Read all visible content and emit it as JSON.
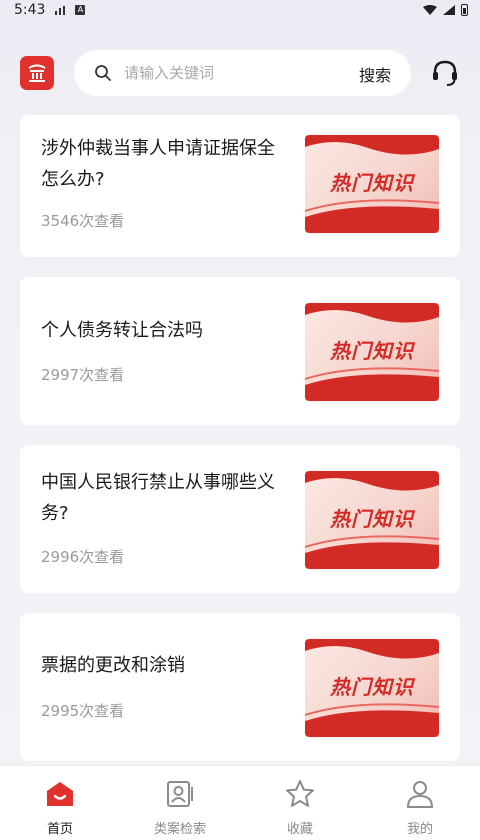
{
  "status": {
    "time": "5:43"
  },
  "search": {
    "placeholder": "请输入关键词",
    "button": "搜索"
  },
  "articles": [
    {
      "title": "涉外仲裁当事人申请证据保全怎么办?",
      "views": "3546次查看",
      "thumb_text": "热门知识"
    },
    {
      "title": "个人债务转让合法吗",
      "views": "2997次查看",
      "thumb_text": "热门知识"
    },
    {
      "title": "中国人民银行禁止从事哪些义务?",
      "views": "2996次查看",
      "thumb_text": "热门知识"
    },
    {
      "title": "票据的更改和涂销",
      "views": "2995次查看",
      "thumb_text": "热门知识"
    }
  ],
  "tabs": [
    {
      "label": "首页",
      "icon": "home-icon",
      "active": true
    },
    {
      "label": "类案检索",
      "icon": "case-search-icon",
      "active": false
    },
    {
      "label": "收藏",
      "icon": "star-icon",
      "active": false
    },
    {
      "label": "我的",
      "icon": "user-icon",
      "active": false
    }
  ],
  "colors": {
    "accent": "#e0312c",
    "background": "#f3f3f6"
  }
}
